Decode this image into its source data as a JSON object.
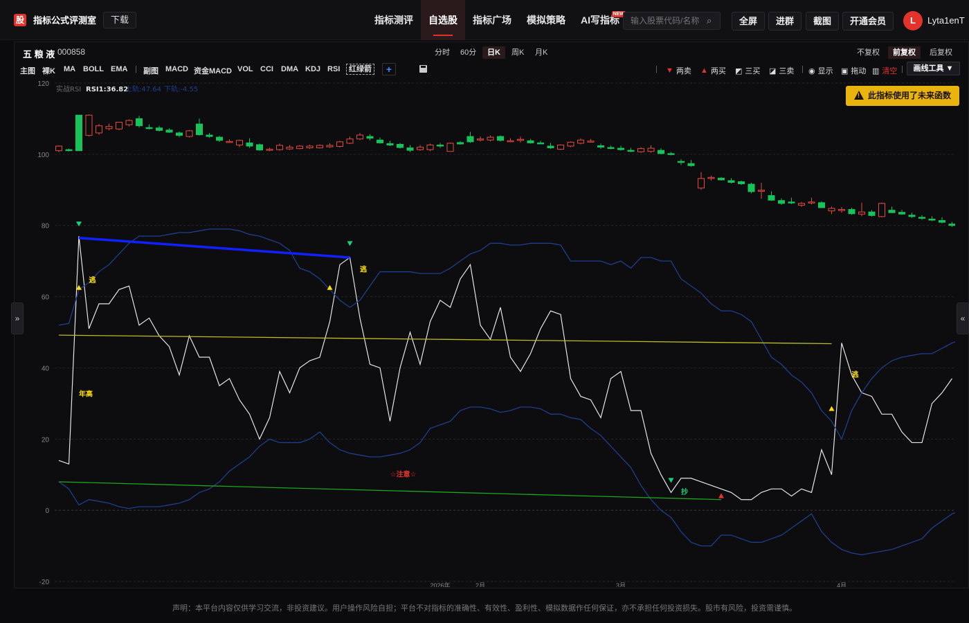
{
  "header": {
    "logo_badge": "股",
    "app_title": "指标公式评测室",
    "download": "下载",
    "nav": [
      {
        "label": "指标测评"
      },
      {
        "label": "自选股"
      },
      {
        "label": "指标广场"
      },
      {
        "label": "模拟策略"
      },
      {
        "label": "AI写指标"
      }
    ],
    "new_badge": "NEW",
    "search_placeholder": "输入股票代码/名称",
    "fullscreen": "全屏",
    "join_group": "进群",
    "screenshot": "截图",
    "membership": "开通会员",
    "avatar_letter": "L",
    "username": "Lyta1enT"
  },
  "stock": {
    "name": "五 粮 液",
    "code": "000858"
  },
  "periods": [
    "分时",
    "60分",
    "日K",
    "周K",
    "月K"
  ],
  "adjust": [
    "不复权",
    "前复权",
    "后复权"
  ],
  "indicators": [
    "主图",
    "裸K",
    "MA",
    "BOLL",
    "EMA",
    "|",
    "副图",
    "MACD",
    "资金MACD",
    "VOL",
    "CCI",
    "DMA",
    "KDJ",
    "RSI",
    "红绿箭"
  ],
  "tools": [
    {
      "glyph": "▼",
      "label": "两卖",
      "color": "#e2342c"
    },
    {
      "glyph": "▲",
      "label": "两买",
      "color": "#e2342c"
    },
    {
      "glyph": "◩",
      "label": "三买",
      "color": "#ddd"
    },
    {
      "glyph": "◪",
      "label": "三卖",
      "color": "#ddd"
    },
    {
      "glyph": "◉",
      "label": "显示",
      "color": "#ddd"
    },
    {
      "glyph": "▣",
      "label": "拖动",
      "color": "#ddd"
    },
    {
      "glyph": "▥",
      "label": "清空",
      "color": "#e2342c"
    }
  ],
  "draw_tool": "画线工具 ▼",
  "warning": "此指标使用了未来函数",
  "legend": {
    "name": "实战RSI",
    "rsi": "RSI1:36.82",
    "upper": "上轨:47.64",
    "lower": "下轨:-4.55"
  },
  "disclaimer": "声明：本平台内容仅供学习交流，非投资建议。用户操作风险自担；平台不对指标的准确性、有效性、盈利性、模拟数据作任何保证，亦不承担任何投资损失。股市有风险，投资需谨慎。",
  "chart_data": {
    "type": "line",
    "y_axis": {
      "ticks": [
        120,
        100,
        80,
        60,
        40,
        20,
        0,
        -20
      ],
      "ylim": [
        -20,
        120
      ]
    },
    "x_labels": [
      {
        "label": "2026年",
        "index": 38
      },
      {
        "label": "2月",
        "index": 42
      },
      {
        "label": "3月",
        "index": 56
      },
      {
        "label": "4月",
        "index": 78
      }
    ],
    "candles": [
      [
        101,
        102.5,
        100.6,
        102.3
      ],
      [
        101.3,
        101.6,
        100.8,
        101.1
      ],
      [
        111,
        111,
        101,
        101
      ],
      [
        105.3,
        111.2,
        105,
        111
      ],
      [
        106,
        108.5,
        105.5,
        108
      ],
      [
        107.2,
        108.6,
        106.7,
        107.8
      ],
      [
        107.1,
        109,
        106.8,
        109
      ],
      [
        108.3,
        109.8,
        107.8,
        109.5
      ],
      [
        110,
        110.8,
        107.5,
        108
      ],
      [
        107.5,
        108.4,
        107,
        107.3
      ],
      [
        107.4,
        108,
        106.4,
        106.7
      ],
      [
        106.8,
        107.3,
        106,
        106.2
      ],
      [
        106,
        106.4,
        104.8,
        105.3
      ],
      [
        105,
        106.8,
        104.7,
        106.6
      ],
      [
        108.5,
        110,
        105.2,
        105.5
      ],
      [
        105.4,
        106,
        104.6,
        105
      ],
      [
        104.8,
        105.2,
        103.5,
        103.9
      ],
      [
        103.6,
        104.2,
        103.2,
        103.6
      ],
      [
        102.6,
        104.1,
        102,
        103.9
      ],
      [
        103.2,
        104.5,
        101.8,
        102.3
      ],
      [
        102.7,
        103,
        101,
        101.2
      ],
      [
        101.2,
        101.8,
        100.9,
        101.4
      ],
      [
        101.3,
        103,
        101,
        102.5
      ],
      [
        101.5,
        102.6,
        101.2,
        102
      ],
      [
        101.6,
        102.6,
        101.4,
        102.3
      ],
      [
        101.8,
        102.7,
        101.5,
        102.3
      ],
      [
        101.8,
        102.8,
        101.6,
        102.5
      ],
      [
        102.1,
        103.1,
        101.8,
        102.5
      ],
      [
        102.2,
        103.8,
        101.9,
        103.5
      ],
      [
        103.1,
        105,
        102.9,
        104.3
      ],
      [
        104.3,
        106,
        104,
        105.4
      ],
      [
        105,
        105.6,
        103.9,
        104.5
      ],
      [
        104,
        104.7,
        103,
        103.2
      ],
      [
        103,
        103.8,
        102.3,
        102.6
      ],
      [
        102.8,
        103.2,
        101.6,
        101.9
      ],
      [
        101.8,
        102.6,
        100.6,
        101.1
      ],
      [
        101.3,
        102.6,
        101,
        102
      ],
      [
        101.3,
        103,
        100.9,
        102.6
      ],
      [
        102.6,
        103.2,
        101.8,
        102.3
      ],
      [
        100.8,
        103.3,
        100.7,
        103.1
      ],
      [
        103.3,
        103.7,
        102.7,
        102.9
      ],
      [
        105,
        106.3,
        103.2,
        103.5
      ],
      [
        104,
        105,
        103.6,
        104.3
      ],
      [
        104,
        105.3,
        103.7,
        104.8
      ],
      [
        105,
        105.3,
        103.6,
        103.9
      ],
      [
        103.8,
        104.5,
        103.4,
        103.8
      ],
      [
        103.9,
        105,
        103.3,
        104.2
      ],
      [
        103.8,
        104.3,
        103,
        103.2
      ],
      [
        103.2,
        103.8,
        102.8,
        103
      ],
      [
        102.3,
        103.2,
        101.5,
        101.8
      ],
      [
        101.4,
        102.8,
        101.2,
        102.6
      ],
      [
        102.3,
        103.6,
        102,
        103.4
      ],
      [
        103.1,
        104.5,
        102.8,
        104
      ],
      [
        103.6,
        104.3,
        103.3,
        103.7
      ],
      [
        102.4,
        103,
        101.5,
        102
      ],
      [
        101.9,
        102.4,
        101.4,
        101.7
      ],
      [
        101.7,
        102.4,
        101,
        101.3
      ],
      [
        101.1,
        101.8,
        100.6,
        100.9
      ],
      [
        100.7,
        102,
        100.4,
        101.6
      ],
      [
        100.8,
        102.5,
        100.4,
        101.7
      ],
      [
        101.1,
        101.7,
        100,
        100.2
      ],
      [
        100.2,
        100.6,
        99.7,
        100
      ],
      [
        98,
        98.6,
        97,
        97.8
      ],
      [
        97.4,
        98.4,
        96.5,
        96.8
      ],
      [
        90.5,
        95,
        90,
        93.2
      ],
      [
        93.2,
        94,
        92.6,
        93.5
      ],
      [
        93.3,
        93.6,
        92.6,
        92.8
      ],
      [
        92.6,
        93.3,
        91.8,
        92.1
      ],
      [
        92.3,
        92.6,
        91.4,
        91.7
      ],
      [
        91.6,
        92,
        89,
        89.5
      ],
      [
        89.8,
        92,
        87.5,
        89.9
      ],
      [
        88.4,
        89.6,
        86.9,
        87.1
      ],
      [
        87,
        87.6,
        85.8,
        86.2
      ],
      [
        86.6,
        87.8,
        86,
        86.5
      ],
      [
        85.7,
        86.6,
        85.2,
        86.2
      ],
      [
        86.3,
        87.8,
        85.9,
        86.6
      ],
      [
        86.4,
        86.8,
        84.9,
        85
      ],
      [
        84.1,
        85.3,
        83.2,
        84.8
      ],
      [
        84.2,
        85.2,
        83.6,
        84.5
      ],
      [
        84.5,
        85,
        83,
        83.3
      ],
      [
        83.2,
        86.4,
        82.6,
        83.8
      ],
      [
        83.8,
        84.3,
        82.5,
        82.8
      ],
      [
        82.5,
        86.4,
        82.3,
        86.2
      ],
      [
        84.3,
        85.3,
        83.5,
        83.6
      ],
      [
        83.7,
        84.4,
        83,
        83.2
      ],
      [
        82.9,
        83.6,
        82.1,
        82.5
      ],
      [
        82.3,
        82.9,
        81.6,
        82
      ],
      [
        81.8,
        82.6,
        81.2,
        81.5
      ],
      [
        81.4,
        82.3,
        80.6,
        80.9
      ],
      [
        80.4,
        81,
        79.6,
        80
      ],
      [
        79.8,
        80.4,
        79.1,
        79.3
      ],
      [
        79.1,
        79.8,
        78.7,
        79
      ],
      [
        79,
        80.4,
        77.7,
        80
      ],
      [
        79.7,
        80.8,
        79.4,
        80.1
      ],
      [
        79.9,
        80.5,
        79.6,
        80.2
      ]
    ],
    "series": [
      {
        "name": "RSI1",
        "values": [
          14,
          13,
          77,
          51,
          58,
          58,
          62,
          63,
          52,
          54,
          49,
          46,
          38,
          49,
          43,
          43,
          35,
          37,
          31,
          27,
          20,
          26,
          39,
          33,
          40,
          42,
          43,
          53,
          69,
          71,
          54,
          41,
          40,
          25,
          40,
          50,
          41,
          53,
          59,
          57,
          65,
          69,
          52,
          48,
          57,
          43,
          39,
          44,
          51,
          56,
          55,
          37,
          32,
          31,
          26,
          37,
          39,
          28,
          28,
          16,
          10,
          5,
          9,
          9,
          8,
          7,
          6,
          5,
          3,
          3,
          5,
          6,
          6,
          4,
          6,
          5,
          17,
          10,
          47,
          38,
          33,
          32,
          27,
          27,
          22,
          19,
          19,
          30,
          33,
          37
        ]
      },
      {
        "name": "上轨",
        "values": [
          52,
          52.5,
          62,
          64,
          67,
          69,
          72,
          75,
          77,
          77,
          77,
          77.5,
          78,
          78,
          78.5,
          79,
          79,
          79,
          78.5,
          77.5,
          77,
          76,
          75,
          73,
          68,
          67,
          65,
          62,
          59,
          57,
          59,
          63,
          67,
          67,
          67,
          67,
          66.5,
          66.5,
          66.5,
          68,
          70,
          72,
          73,
          75,
          75,
          74.5,
          74.5,
          75,
          75,
          75,
          74.5,
          70,
          70,
          70,
          70,
          69,
          70,
          68,
          71,
          71,
          70,
          70,
          65,
          63,
          61,
          58,
          56,
          56,
          55,
          53,
          48,
          43,
          41,
          38,
          36,
          33,
          28,
          25,
          20,
          28,
          33,
          37,
          40,
          42,
          43,
          43.5,
          44,
          44,
          45.5,
          47,
          48
        ]
      },
      {
        "name": "下轨",
        "values": [
          8,
          6,
          1.5,
          3,
          2.5,
          2,
          1,
          0.5,
          1,
          1,
          1,
          1.5,
          2,
          3,
          5,
          6,
          8,
          11,
          13,
          15,
          18,
          20,
          19,
          19,
          19,
          20,
          22,
          19,
          17,
          16,
          15.5,
          15,
          15,
          15.5,
          16,
          17,
          19,
          23,
          24,
          25,
          28,
          29,
          29,
          28.5,
          27.5,
          28,
          29,
          29,
          28.5,
          27,
          27,
          26,
          25.5,
          23,
          21,
          18,
          15,
          12,
          7,
          3,
          0,
          -2,
          -6,
          -9,
          -10,
          -10,
          -7,
          -7,
          -8,
          -9,
          -9,
          -8,
          -7,
          -5,
          -3,
          -1,
          -6,
          -9,
          -11,
          -12,
          -12.5,
          -12,
          -11.5,
          -11,
          -10,
          -9,
          -8,
          -5,
          -3,
          -1,
          0
        ]
      },
      {
        "name": "",
        "values": [
          null
        ]
      }
    ],
    "trend_lines": [
      {
        "color": "#1020ff",
        "from": [
          2,
          76.5
        ],
        "to": [
          29,
          71
        ]
      },
      {
        "color": "#bdbd1f",
        "from": [
          0,
          49.2
        ],
        "to": [
          77,
          46.8
        ]
      },
      {
        "color": "#1ea51e",
        "from": [
          0,
          8
        ],
        "to": [
          66,
          3
        ]
      }
    ],
    "markers": [
      {
        "type": "down",
        "color": "#18d27a",
        "index": 2,
        "value": 80.5
      },
      {
        "type": "down",
        "color": "#18d27a",
        "index": 29,
        "value": 75
      },
      {
        "type": "down",
        "color": "#18d27a",
        "index": 61,
        "value": 8.5
      },
      {
        "type": "up",
        "color": "#ffe000",
        "index": 2,
        "value": 62.5
      },
      {
        "type": "up",
        "color": "#ffe000",
        "index": 27,
        "value": 62.5
      },
      {
        "type": "up",
        "color": "#ffe000",
        "index": 77,
        "value": 28.5
      },
      {
        "type": "up",
        "color": "#e2342c",
        "index": 66,
        "value": 4
      }
    ],
    "annotations": [
      {
        "text": "逃",
        "color": "#ffe000",
        "index": 3,
        "value": 64
      },
      {
        "text": "逃",
        "color": "#ffe000",
        "index": 30,
        "value": 67
      },
      {
        "text": "逃",
        "color": "#ffe000",
        "index": 79,
        "value": 37.5
      },
      {
        "text": "年高",
        "color": "#ffe000",
        "index": 2,
        "value": 32
      },
      {
        "text": "☆注意☆",
        "color": "#e2342c",
        "index": 33,
        "value": 9.5
      },
      {
        "text": "抄",
        "color": "#18d27a",
        "index": 62,
        "value": 4.5
      }
    ]
  }
}
